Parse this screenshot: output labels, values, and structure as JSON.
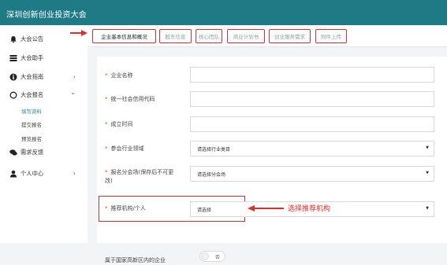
{
  "app": {
    "title": "深圳创新创业投资大会"
  },
  "sidebar": {
    "items": [
      {
        "label": "大会公告",
        "icon": "bell-icon",
        "chevron": ""
      },
      {
        "label": "大会助手",
        "icon": "list-icon",
        "chevron": ""
      },
      {
        "label": "大会指南",
        "icon": "info-icon",
        "chevron": "›"
      },
      {
        "label": "大会报名",
        "icon": "circle-icon",
        "chevron": "⌄"
      },
      {
        "label": "需求反馈",
        "icon": "chat-icon",
        "chevron": ""
      },
      {
        "label": "个人中心",
        "icon": "user-icon",
        "chevron": "›"
      }
    ],
    "subitems": [
      {
        "label": "填写资料",
        "active": true
      },
      {
        "label": "提交报名",
        "active": false
      },
      {
        "label": "预览报名",
        "active": false
      }
    ]
  },
  "tabs": [
    {
      "label": "企业基本信息和概况",
      "active": true
    },
    {
      "label": "股东信息",
      "active": false
    },
    {
      "label": "核心团队",
      "active": false
    },
    {
      "label": "商业计划书",
      "active": false
    },
    {
      "label": "创业服务需求",
      "active": false
    },
    {
      "label": "附件上传",
      "active": false
    }
  ],
  "form": {
    "company_name": {
      "label": "企业名称",
      "value": ""
    },
    "credit_code": {
      "label": "统一社会信用代码",
      "value": ""
    },
    "founded": {
      "label": "成立时间",
      "value": ""
    },
    "industry": {
      "label": "参会行业领域",
      "value": "请选择行业类目"
    },
    "venue_line1": {
      "label": "报名分会场(保存后不可更",
      "value": "请选择分会场"
    },
    "venue_line2": {
      "label": "改)"
    },
    "referrer": {
      "label": "推荐机构/个人",
      "value": "请选择"
    },
    "high_tech_zone": {
      "label": "属于国家高新区内的企业",
      "toggle_text": "否"
    }
  },
  "annotation": {
    "text": "选择推荐机构"
  }
}
